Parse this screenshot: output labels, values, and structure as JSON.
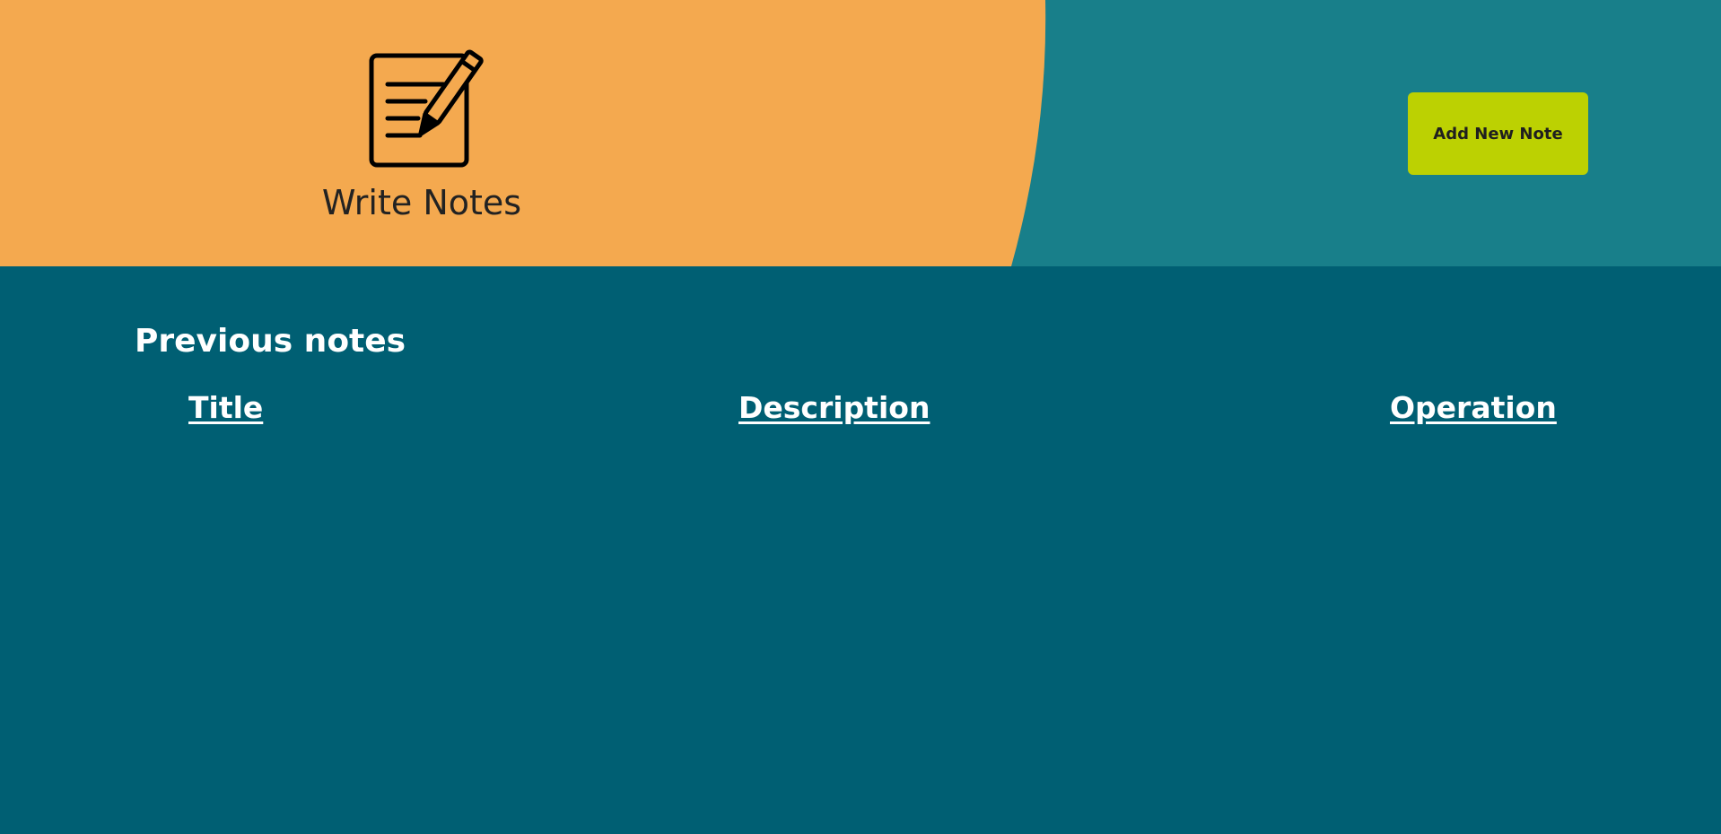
{
  "header": {
    "app_title": "Write Notes",
    "logo_icon": "note-with-pencil-icon",
    "add_button_label": "Add New Note",
    "colors": {
      "left_panel": "#f4a94f",
      "right_panel": "#187f8a",
      "button": "#bcd102"
    }
  },
  "main": {
    "section_title": "Previous notes",
    "table": {
      "columns": [
        "Title",
        "Description",
        "Operation"
      ],
      "rows": []
    },
    "background": "#005f73"
  }
}
